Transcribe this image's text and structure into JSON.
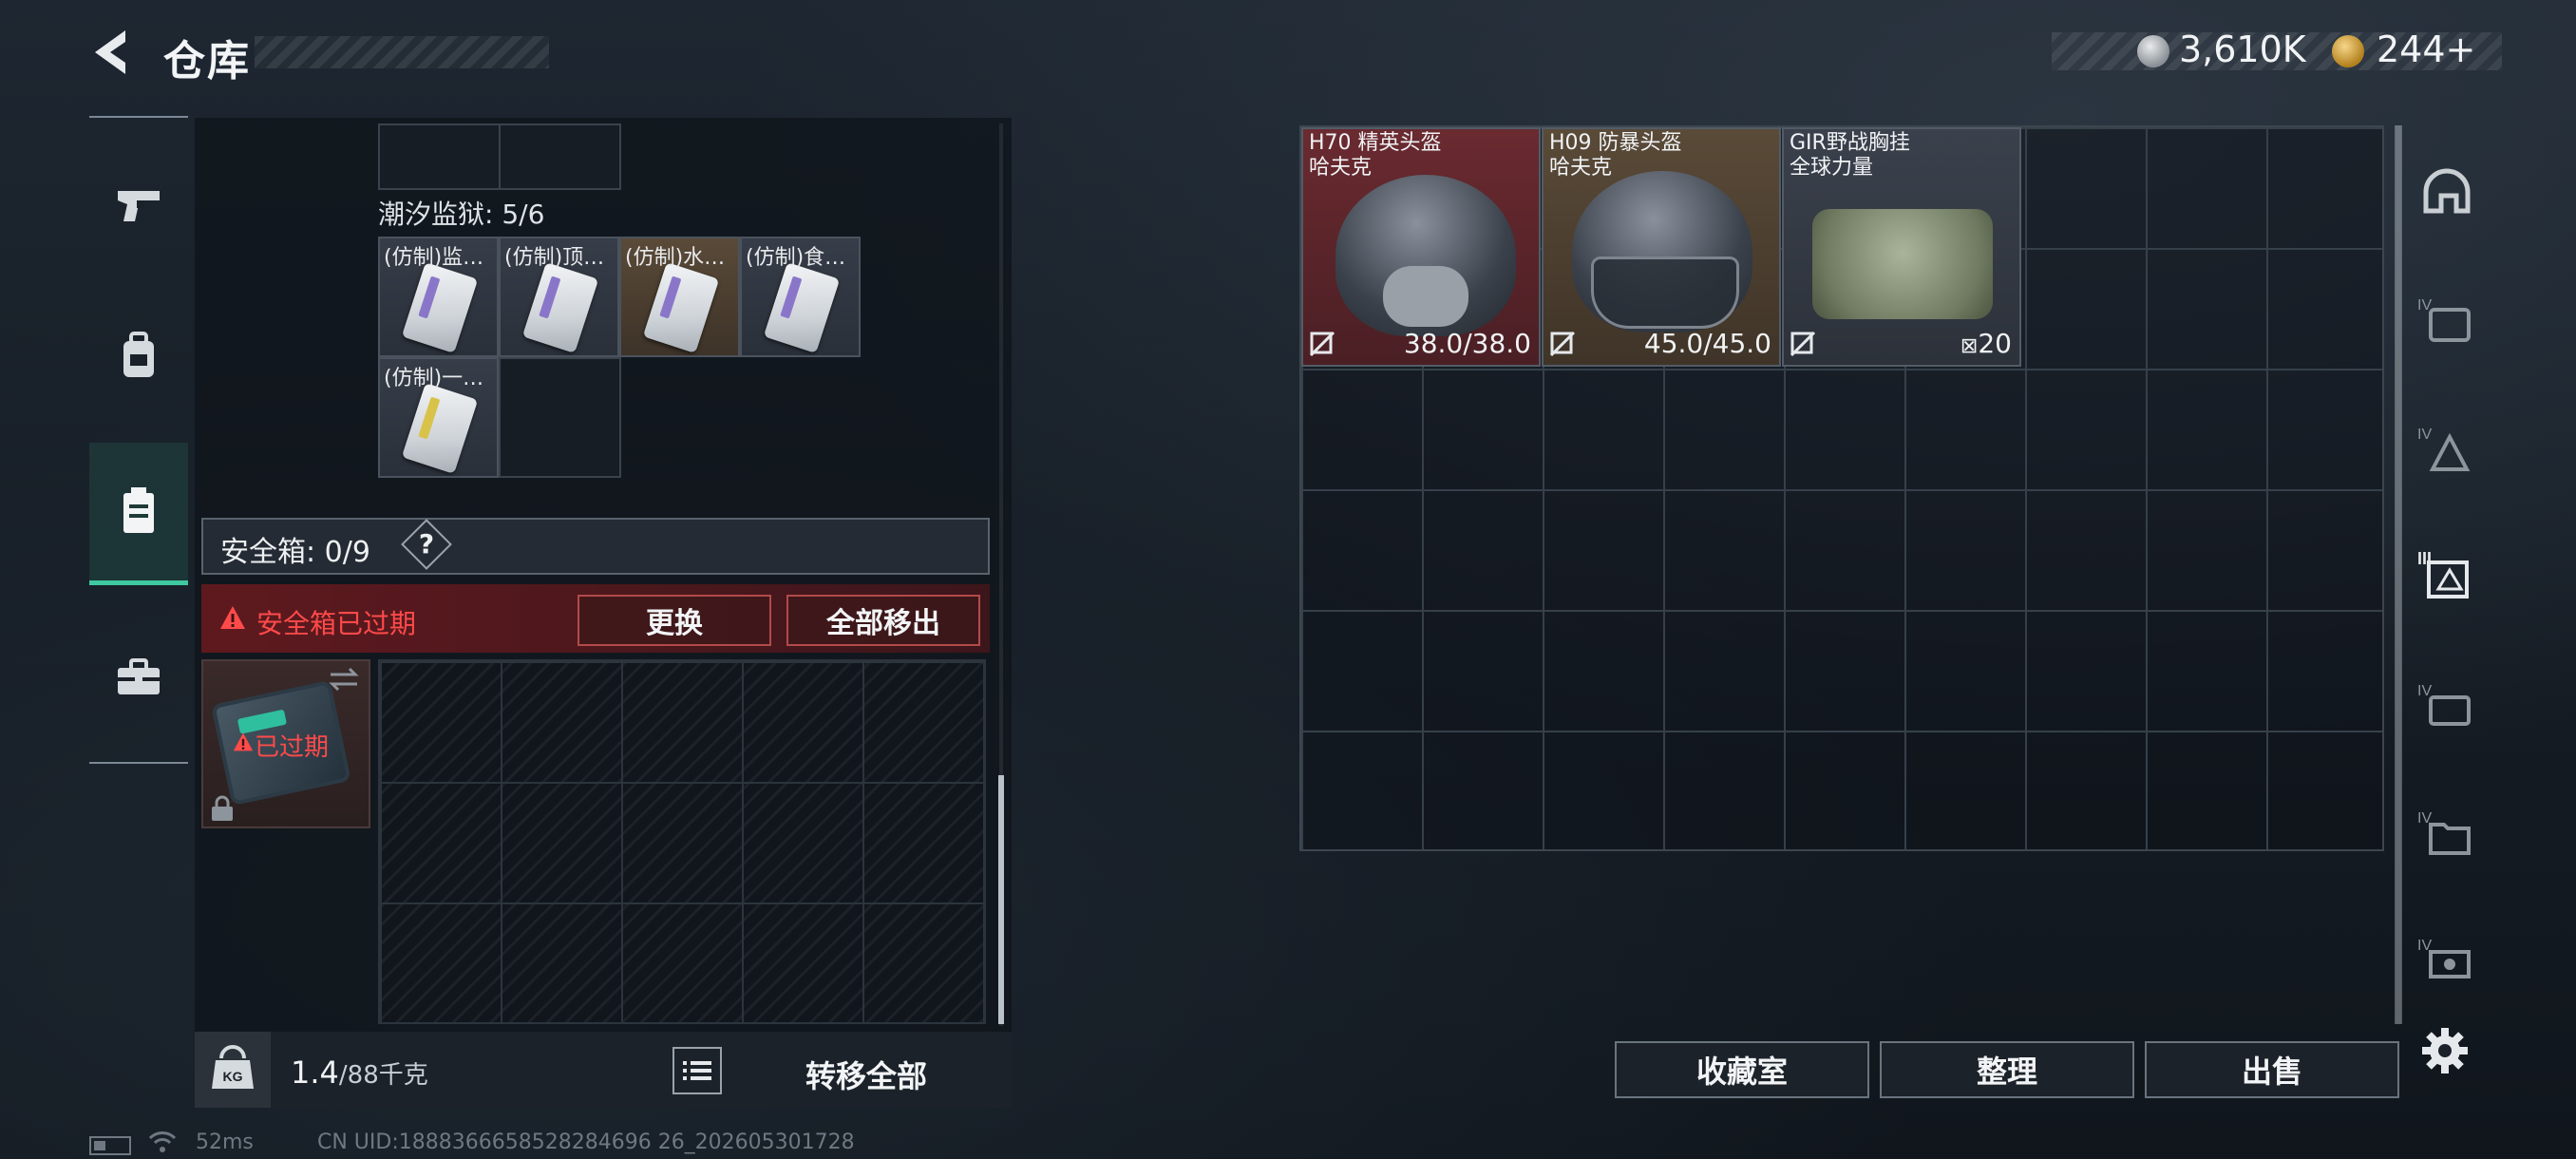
{
  "header": {
    "title": "仓库",
    "back_icon": "back-arrow-icon"
  },
  "currency": {
    "silver": {
      "icon": "silver-coin-icon",
      "amount": "3,610K"
    },
    "gold": {
      "icon": "gold-coin-icon",
      "amount": "244+"
    }
  },
  "left_nav": {
    "items": [
      {
        "icon": "pistol-icon",
        "active": false
      },
      {
        "icon": "backpack-icon",
        "active": false
      },
      {
        "icon": "container-icon",
        "active": true
      },
      {
        "icon": "toolbox-icon",
        "active": false
      }
    ],
    "active_color": "#3fc9a0"
  },
  "container": {
    "section_label": "潮汐监狱: 5/6",
    "items": [
      {
        "label": "(仿制)监…",
        "style": "gray",
        "icon": "keycard-icon"
      },
      {
        "label": "(仿制)顶…",
        "style": "gray",
        "icon": "keycard-icon"
      },
      {
        "label": "(仿制)水…",
        "style": "brown",
        "icon": "keycard-icon"
      },
      {
        "label": "(仿制)食…",
        "style": "gray",
        "icon": "keycard-icon"
      },
      {
        "label": "(仿制)一…",
        "style": "gray",
        "icon": "keycard-icon"
      }
    ]
  },
  "safe_box": {
    "title": "安全箱: 0/9",
    "help": "?",
    "expired_message": "安全箱已过期",
    "replace_label": "更换",
    "move_all_out_label": "全部移出",
    "case_status": "已过期",
    "warning_color": "#ff4a4a"
  },
  "weight": {
    "current": "1.4",
    "capacity": "/88千克",
    "transfer_all_label": "转移全部"
  },
  "gear": [
    {
      "name": "H70 精英头盔",
      "brand": "哈夫克",
      "value": "38.0/38.0",
      "rarity_color": "#6a2a30"
    },
    {
      "name": "H09 防暴头盔",
      "brand": "哈夫克",
      "value": "45.0/45.0",
      "rarity_color": "#5a4a38"
    },
    {
      "name": "GIR野战胸挂",
      "brand": "全球力量",
      "value": "20",
      "rarity_color": "#3b414c"
    }
  ],
  "right_sidebar": {
    "icons": [
      "helmet-slot-icon",
      "armor-slot-iv-icon",
      "rig-slot-iv-icon",
      "storage-iii-icon",
      "storage-iv-icon",
      "storage-iv-folder-icon",
      "storage-iv-sign-icon"
    ]
  },
  "bottom_buttons": {
    "collection": "收藏室",
    "organize": "整理",
    "sell": "出售"
  },
  "status": {
    "ping": "52ms",
    "uid": "CN UID:1888366658528284696 26_202605301728"
  }
}
